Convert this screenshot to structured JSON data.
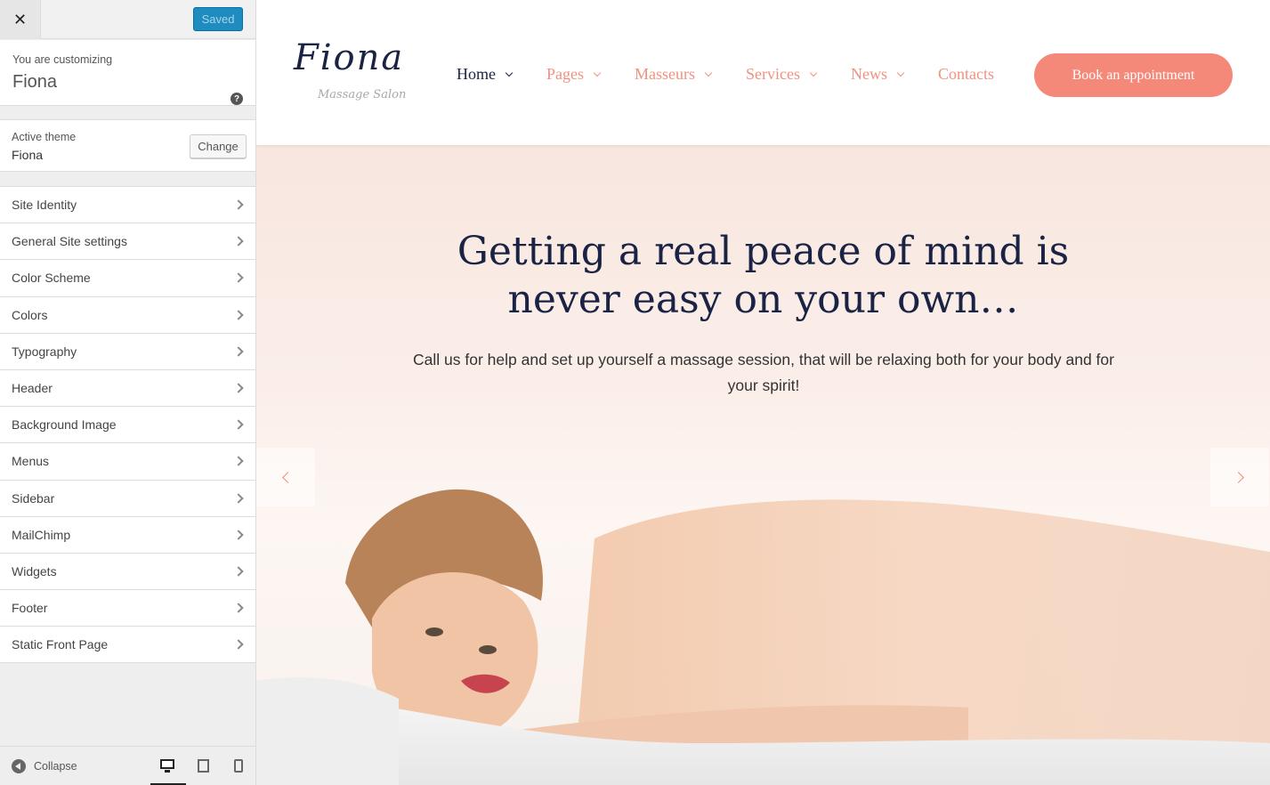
{
  "customizer": {
    "close_symbol": "✕",
    "saved_label": "Saved",
    "customizing_label": "You are customizing",
    "site_name": "Fiona",
    "help_symbol": "?",
    "active_theme_label": "Active theme",
    "active_theme_name": "Fiona",
    "change_label": "Change",
    "panels": [
      {
        "label": "Site Identity"
      },
      {
        "label": "General Site settings"
      },
      {
        "label": "Color Scheme"
      },
      {
        "label": "Colors"
      },
      {
        "label": "Typography"
      },
      {
        "label": "Header"
      },
      {
        "label": "Background Image"
      },
      {
        "label": "Menus"
      },
      {
        "label": "Sidebar"
      },
      {
        "label": "MailChimp"
      },
      {
        "label": "Widgets"
      },
      {
        "label": "Footer"
      },
      {
        "label": "Static Front Page"
      }
    ],
    "collapse_label": "Collapse",
    "devices": [
      "desktop-icon",
      "tablet-icon",
      "mobile-icon"
    ],
    "selected_device": "desktop"
  },
  "site": {
    "logo_text": "Fiona",
    "logo_subtitle": "Massage Salon",
    "nav": [
      {
        "label": "Home",
        "active": true,
        "dropdown": true
      },
      {
        "label": "Pages",
        "active": false,
        "dropdown": true
      },
      {
        "label": "Masseurs",
        "active": false,
        "dropdown": true
      },
      {
        "label": "Services",
        "active": false,
        "dropdown": true
      },
      {
        "label": "News",
        "active": false,
        "dropdown": true
      },
      {
        "label": "Contacts",
        "active": false,
        "dropdown": false
      }
    ],
    "cta_label": "Book an appointment",
    "hero": {
      "title_line1": "Getting a real peace of mind is",
      "title_line2": "never easy on your own…",
      "text": "Call us for help and set up yourself a massage session, that will be relaxing both for your body and for your spirit!"
    }
  },
  "colors": {
    "accent": "#f4897a",
    "nav_active": "#1a2344",
    "wp_blue": "#1e8cbe"
  }
}
